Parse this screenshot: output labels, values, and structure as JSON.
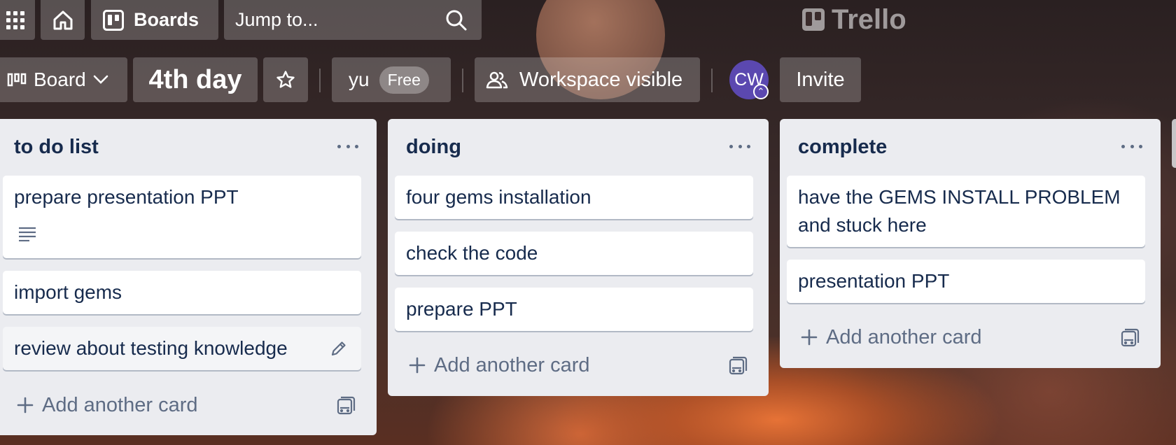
{
  "topbar": {
    "boards_label": "Boards",
    "search_placeholder": "Jump to...",
    "logo_text": "Trello"
  },
  "board_header": {
    "view_label": "Board",
    "board_title": "4th day",
    "workspace_name": "yu",
    "workspace_plan": "Free",
    "visibility_label": "Workspace visible",
    "avatar_initials": "CW",
    "invite_label": "Invite"
  },
  "lists": [
    {
      "title": "to do list",
      "cards": [
        {
          "text": "prepare presentation PPT",
          "has_description": true
        },
        {
          "text": "import gems"
        },
        {
          "text": "review about testing knowledge",
          "hover": true
        }
      ],
      "add_label": "Add another card"
    },
    {
      "title": "doing",
      "cards": [
        {
          "text": "four gems installation"
        },
        {
          "text": "check the code"
        },
        {
          "text": "prepare PPT"
        }
      ],
      "add_label": "Add another card"
    },
    {
      "title": "complete",
      "cards": [
        {
          "text": "have the GEMS INSTALL PROBLEM and stuck here"
        },
        {
          "text": "presentation PPT"
        }
      ],
      "add_label": "Add another card"
    }
  ],
  "icons": [
    "apps-grid-icon",
    "home-icon",
    "boards-icon",
    "search-icon",
    "trello-logo-icon",
    "board-view-icon",
    "chevron-down-icon",
    "star-icon",
    "people-icon",
    "list-menu-icon",
    "description-icon",
    "edit-pencil-icon",
    "plus-icon",
    "template-icon"
  ],
  "colors": {
    "card_text": "#172b4d",
    "list_bg": "#ebecf0",
    "avatar": "#5b48b0",
    "muted_text": "#5e6c84"
  }
}
